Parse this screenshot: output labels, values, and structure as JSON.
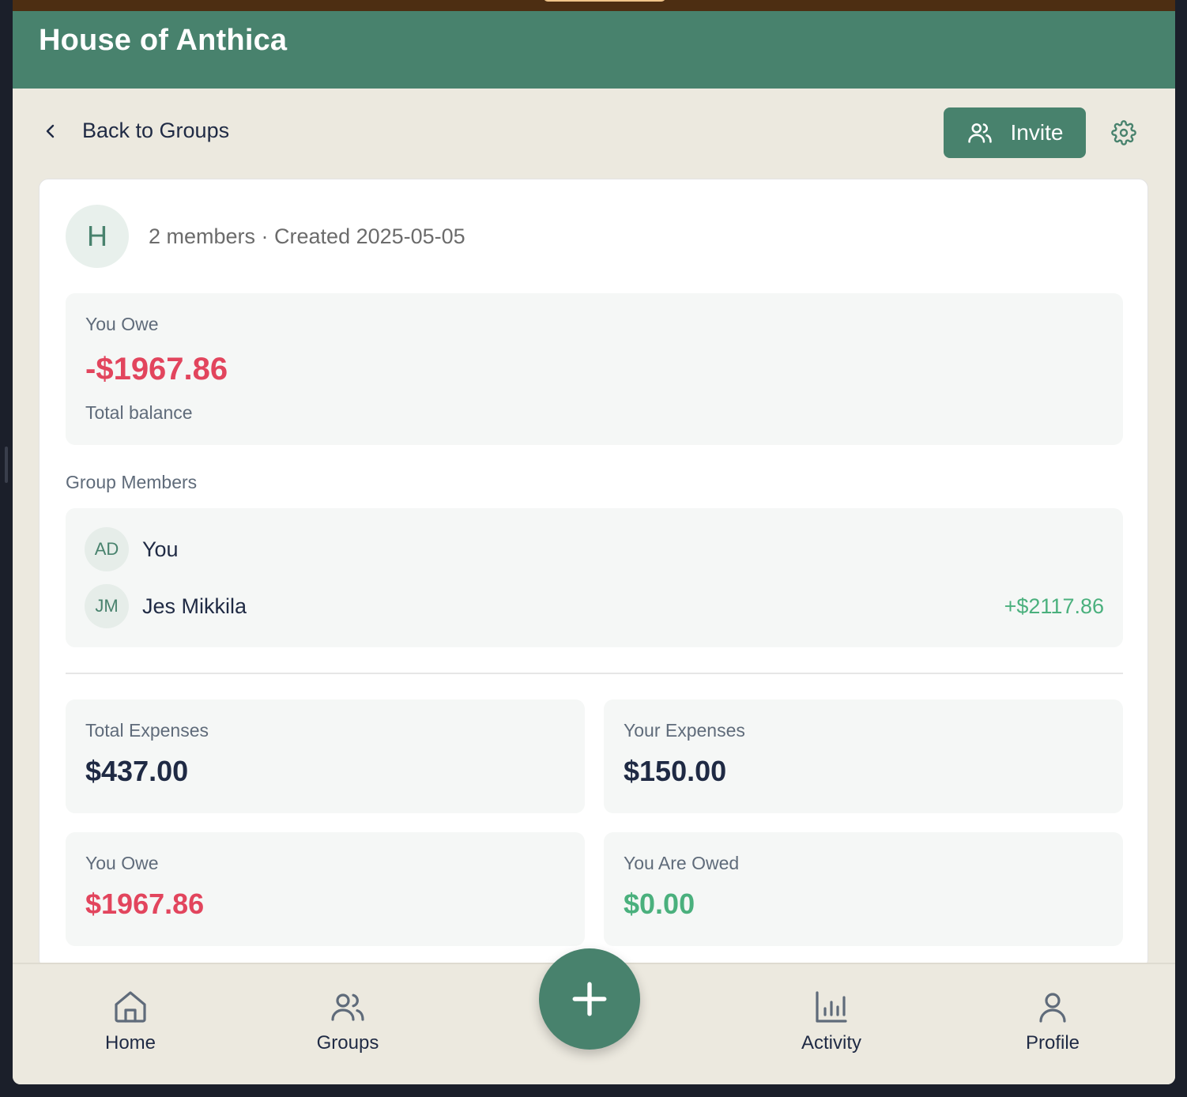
{
  "app": {
    "title": "House of Anthica"
  },
  "toolbar": {
    "back_label": "Back to Groups",
    "invite_label": "Invite"
  },
  "group": {
    "avatar_letter": "H",
    "meta": "2 members · Created 2025-05-05"
  },
  "balance": {
    "title": "You Owe",
    "value": "-$1967.86",
    "subtitle": "Total balance"
  },
  "members": {
    "title": "Group Members",
    "items": [
      {
        "initials": "AD",
        "name": "You",
        "amount": ""
      },
      {
        "initials": "JM",
        "name": "Jes Mikkila",
        "amount": "+$2117.86"
      }
    ]
  },
  "stats": {
    "total_expenses": {
      "label": "Total Expenses",
      "value": "$437.00"
    },
    "your_expenses": {
      "label": "Your Expenses",
      "value": "$150.00"
    },
    "you_owe": {
      "label": "You Owe",
      "value": "$1967.86"
    },
    "you_are_owed": {
      "label": "You Are Owed",
      "value": "$0.00"
    }
  },
  "nav": {
    "home": "Home",
    "groups": "Groups",
    "activity": "Activity",
    "profile": "Profile"
  },
  "colors": {
    "brand": "#48826d",
    "negative": "#e2455d",
    "positive": "#4ab07d",
    "background": "#ece9df"
  }
}
